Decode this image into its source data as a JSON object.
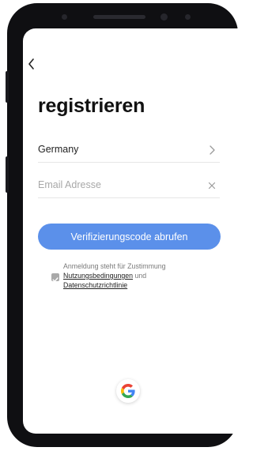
{
  "page": {
    "title": "registrieren"
  },
  "form": {
    "country_value": "Germany",
    "email_placeholder": "Email Adresse",
    "submit_label": "Verifizierungscode abrufen"
  },
  "consent": {
    "prefix": "Anmeldung steht für Zustimmung",
    "terms_label": "Nutzungsbedingungen",
    "connector": "und",
    "privacy_label": "Datenschutzrichtlinie",
    "checked": true
  },
  "icons": {
    "back": "back-arrow-icon",
    "chevron": "chevron-right-icon",
    "clear": "clear-icon",
    "social": "google-icon",
    "checkbox": "checkbox-icon"
  },
  "colors": {
    "accent": "#5b90ea",
    "checkbox": "#a9a9a9",
    "divider": "#e6e6e6"
  }
}
